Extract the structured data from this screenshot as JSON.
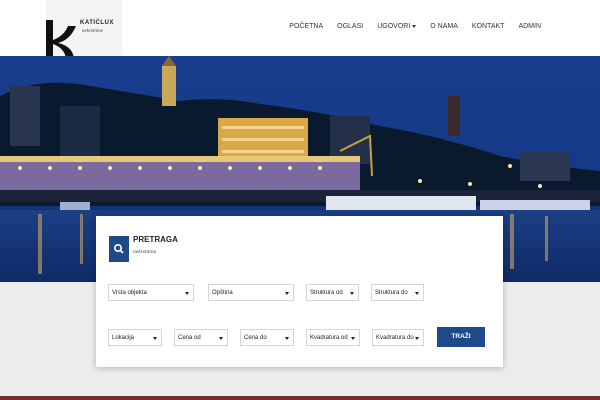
{
  "brand": {
    "name": "KATIĆLUX",
    "subtitle": "nekretnine"
  },
  "nav": [
    {
      "label": "POČETNA"
    },
    {
      "label": "OGLASI"
    },
    {
      "label": "UGOVORI",
      "dropdown": true
    },
    {
      "label": "O NAMA"
    },
    {
      "label": "KONTAKT"
    },
    {
      "label": "ADMIN"
    }
  ],
  "hero": {
    "description_icon": "city-night-panorama"
  },
  "search": {
    "title": "PRETRAGA",
    "subtitle": "nekretnina",
    "row1": [
      "Vrsta objekta",
      "Opština",
      "Struktura od",
      "Struktura do"
    ],
    "row2": [
      "Lokacija",
      "Cena od",
      "Cena do",
      "Kvadratura od",
      "Kvadratura do"
    ],
    "button_label": "TRAŽI"
  },
  "colors": {
    "accent": "#1f4a8a",
    "header_bg": "#ffffff",
    "page_bg": "#ececec"
  }
}
